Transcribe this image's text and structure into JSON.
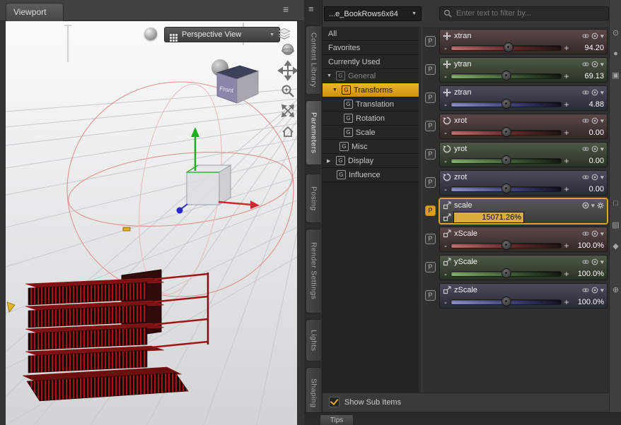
{
  "viewport": {
    "tab": "Viewport",
    "view_dropdown": "Perspective View",
    "cube_front_label": "Front"
  },
  "side_tabs": {
    "items": [
      {
        "label": "Content Library",
        "selected": false
      },
      {
        "label": "Parameters",
        "selected": true
      },
      {
        "label": "Posing",
        "selected": false
      },
      {
        "label": "Render Settings",
        "selected": false
      },
      {
        "label": "Lights",
        "selected": false
      },
      {
        "label": "Shaping",
        "selected": false
      }
    ]
  },
  "right_panel": {
    "scene_dropdown": "...e_BookRows6x64",
    "filter_placeholder": "Enter text to filter by...",
    "nav": {
      "items": [
        {
          "label": "All"
        },
        {
          "label": "Favorites"
        },
        {
          "label": "Currently Used"
        }
      ],
      "tree": [
        {
          "label": "General",
          "level": 0,
          "state": "expanded",
          "dimmed": true
        },
        {
          "label": "Transforms",
          "level": 1,
          "state": "expanded",
          "selected": true
        },
        {
          "label": "Translation",
          "level": 2
        },
        {
          "label": "Rotation",
          "level": 2
        },
        {
          "label": "Scale",
          "level": 2
        },
        {
          "label": "Misc",
          "level": 1
        },
        {
          "label": "Display",
          "level": 0,
          "state": "collapsed"
        },
        {
          "label": "Influence",
          "level": 1
        }
      ]
    },
    "sliders": [
      {
        "name": "xtran",
        "value": "94.20",
        "axis": "x",
        "control": "translate"
      },
      {
        "name": "ytran",
        "value": "69.13",
        "axis": "y",
        "control": "translate"
      },
      {
        "name": "ztran",
        "value": "4.88",
        "axis": "z",
        "control": "translate"
      },
      {
        "name": "xrot",
        "value": "0.00",
        "axis": "x",
        "control": "rotate"
      },
      {
        "name": "yrot",
        "value": "0.00",
        "axis": "y",
        "control": "rotate"
      },
      {
        "name": "zrot",
        "value": "0.00",
        "axis": "z",
        "control": "rotate"
      },
      {
        "name": "scale",
        "value": "15071.26%",
        "axis": "all",
        "control": "scale",
        "editing": true
      },
      {
        "name": "xScale",
        "value": "100.0%",
        "axis": "x",
        "control": "scale"
      },
      {
        "name": "yScale",
        "value": "100.0%",
        "axis": "y",
        "control": "scale"
      },
      {
        "name": "zScale",
        "value": "100.0%",
        "axis": "z",
        "control": "scale"
      }
    ],
    "show_sub_items": "Show Sub Items"
  },
  "bottom_bar": {
    "tips_tab": "Tips"
  },
  "icons": {
    "param_letter": "P",
    "group_letter": "G",
    "minus": "-",
    "plus": "+",
    "caret_down": "▼",
    "expanded": "▼",
    "collapsed": "▶",
    "pane_menu": "≡",
    "heart": "♥",
    "strip": [
      "⊙",
      "●",
      "▣",
      "□",
      "▤",
      "◆",
      "⊕"
    ]
  },
  "colors": {
    "selection": "#DD9F1B",
    "x_axis": "#C47070",
    "y_axis": "#86B26E",
    "z_axis": "#8F92C8",
    "value_field": "#D9AD3E"
  }
}
